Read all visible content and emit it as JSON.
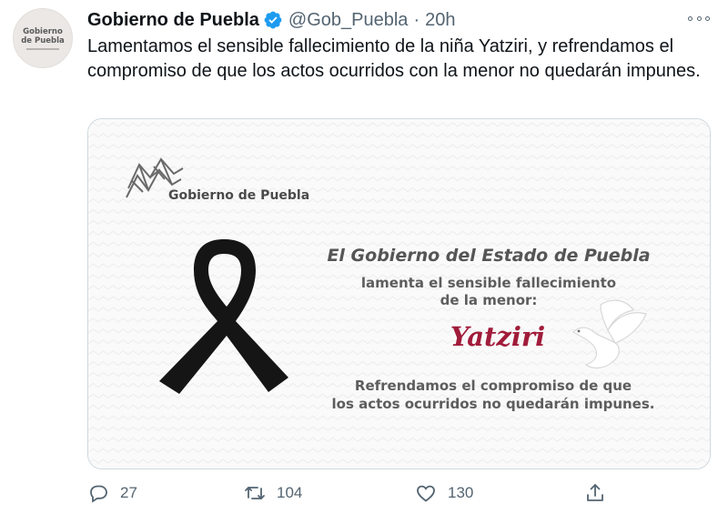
{
  "tweet": {
    "avatar": {
      "line1": "Gobierno",
      "line2": "de Puebla"
    },
    "display_name": "Gobierno de Puebla",
    "handle": "@Gob_Puebla",
    "separator": "·",
    "time": "20h",
    "text": "Lamentamos el sensible fallecimiento de la niña Yatziri, y refrendamos el compromiso de que los actos ocurridos con la menor no quedarán impunes."
  },
  "card": {
    "logo_text": "Gobierno de Puebla",
    "headline": "El Gobierno del Estado de Puebla",
    "subline1": "lamenta el sensible fallecimiento",
    "subline2": "de la menor:",
    "name": "Yatziri",
    "closing1": "Refrendamos el compromiso de que",
    "closing2": "los actos ocurridos no quedarán impunes.",
    "name_color": "#a11b3a"
  },
  "actions": {
    "reply_count": "27",
    "retweet_count": "104",
    "like_count": "130"
  },
  "icons": [
    "verified-icon",
    "more-icon",
    "reply-icon",
    "retweet-icon",
    "like-icon",
    "share-icon",
    "ribbon-icon",
    "dove-icon",
    "puebla-logo-icon"
  ],
  "colors": {
    "verified": "#1d9bf0",
    "secondary_text": "#536471"
  }
}
